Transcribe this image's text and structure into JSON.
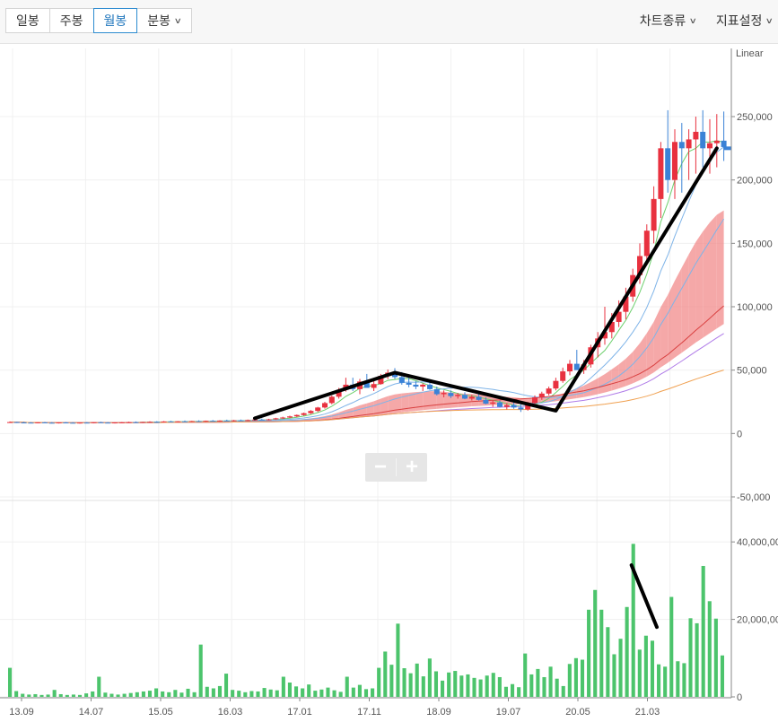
{
  "tabs": [
    {
      "label": "일봉",
      "active": false
    },
    {
      "label": "주봉",
      "active": false
    },
    {
      "label": "월봉",
      "active": true
    },
    {
      "label": "분봉",
      "active": false,
      "dropdown": true
    }
  ],
  "menu": {
    "chart_type": "차트종류",
    "indicator_settings": "지표설정"
  },
  "zoom": {
    "minus": "−",
    "plus": "+"
  },
  "colors": {
    "up": "#e8313f",
    "down": "#3b82d6",
    "volume": "#4cc46c",
    "cloud_down": "#a9cdf3",
    "cloud_up": "#f28b8b",
    "trendline": "#000000"
  },
  "chart_data": [
    {
      "type": "candlestick",
      "scale_label": "Linear",
      "ylim": [
        -50000,
        250000
      ],
      "y_ticks": [
        {
          "value": 250000,
          "label": "250,000"
        },
        {
          "value": 200000,
          "label": "200,000"
        },
        {
          "value": 150000,
          "label": "150,000"
        },
        {
          "value": 100000,
          "label": "100,000"
        },
        {
          "value": 50000,
          "label": "50,000"
        },
        {
          "value": 0,
          "label": "0"
        },
        {
          "value": -50000,
          "label": "-50,000"
        }
      ],
      "x_ticks": [
        "13.09",
        "14.07",
        "15.05",
        "16.03",
        "17.01",
        "17.11",
        "18.09",
        "19.07",
        "20.05",
        "21.03"
      ],
      "period_count": 103,
      "ohlc": [
        [
          9000,
          9500,
          8500,
          9000
        ],
        [
          9000,
          9200,
          8300,
          8700
        ],
        [
          8700,
          9100,
          8200,
          8600
        ],
        [
          8600,
          9000,
          8100,
          8400
        ],
        [
          8400,
          8900,
          8000,
          8800
        ],
        [
          8800,
          9200,
          8300,
          8500
        ],
        [
          8500,
          9000,
          8000,
          8300
        ],
        [
          8300,
          8800,
          7900,
          8700
        ],
        [
          8700,
          9100,
          8200,
          8500
        ],
        [
          8500,
          8900,
          8000,
          8200
        ],
        [
          8200,
          8700,
          7800,
          8600
        ],
        [
          8600,
          9000,
          8100,
          8400
        ],
        [
          8400,
          8800,
          8000,
          8900
        ],
        [
          8900,
          9300,
          8400,
          8600
        ],
        [
          8600,
          9000,
          8100,
          8300
        ],
        [
          8300,
          8800,
          7900,
          8700
        ],
        [
          8700,
          9100,
          8200,
          8800
        ],
        [
          8800,
          9300,
          8300,
          9000
        ],
        [
          9000,
          9500,
          8500,
          8700
        ],
        [
          8700,
          9200,
          8200,
          9100
        ],
        [
          9100,
          9600,
          8600,
          9200
        ],
        [
          9200,
          9700,
          8700,
          9000
        ],
        [
          9000,
          9800,
          8600,
          9500
        ],
        [
          9500,
          10000,
          9000,
          9200
        ],
        [
          9200,
          9800,
          8800,
          9600
        ],
        [
          9600,
          10200,
          9100,
          9400
        ],
        [
          9400,
          10000,
          9000,
          9800
        ],
        [
          9800,
          10400,
          9300,
          9600
        ],
        [
          9600,
          10200,
          9100,
          10000
        ],
        [
          10000,
          10600,
          9500,
          9800
        ],
        [
          9800,
          10400,
          9300,
          10200
        ],
        [
          10200,
          10900,
          9700,
          10000
        ],
        [
          10000,
          10700,
          9500,
          10400
        ],
        [
          10400,
          11000,
          9900,
          10200
        ],
        [
          10200,
          11000,
          9800,
          10600
        ],
        [
          10600,
          11400,
          10100,
          11000
        ],
        [
          11000,
          11800,
          10500,
          10800
        ],
        [
          10800,
          11600,
          10300,
          11200
        ],
        [
          11200,
          12400,
          10700,
          12000
        ],
        [
          12000,
          13200,
          11500,
          12600
        ],
        [
          12600,
          14000,
          12100,
          13500
        ],
        [
          13500,
          15000,
          12900,
          14600
        ],
        [
          14600,
          16500,
          14000,
          16000
        ],
        [
          16000,
          18500,
          15300,
          17800
        ],
        [
          17800,
          21000,
          17000,
          20500
        ],
        [
          20500,
          25000,
          19600,
          24000
        ],
        [
          24000,
          30000,
          23000,
          29000
        ],
        [
          29000,
          36000,
          27500,
          34500
        ],
        [
          34500,
          44000,
          33000,
          38500
        ],
        [
          38500,
          44000,
          33500,
          35000
        ],
        [
          35000,
          43000,
          31000,
          41000
        ],
        [
          41000,
          47000,
          36500,
          36000
        ],
        [
          36000,
          43000,
          33500,
          39000
        ],
        [
          39000,
          47000,
          38500,
          45500
        ],
        [
          45500,
          50500,
          43000,
          48000
        ],
        [
          48000,
          51500,
          43000,
          44500
        ],
        [
          44500,
          48500,
          38500,
          40000
        ],
        [
          40000,
          44000,
          36500,
          38500
        ],
        [
          38500,
          41500,
          35000,
          37000
        ],
        [
          37000,
          39500,
          33500,
          38500
        ],
        [
          38500,
          41000,
          34500,
          35000
        ],
        [
          35000,
          37000,
          30000,
          31000
        ],
        [
          31000,
          34000,
          28500,
          32000
        ],
        [
          32000,
          34000,
          28000,
          29500
        ],
        [
          29500,
          32000,
          27500,
          30500
        ],
        [
          30500,
          32500,
          27000,
          27500
        ],
        [
          27500,
          30500,
          26000,
          29000
        ],
        [
          29000,
          31000,
          26000,
          26500
        ],
        [
          26500,
          28500,
          23000,
          23500
        ],
        [
          23500,
          26000,
          21000,
          24500
        ],
        [
          24500,
          26000,
          20500,
          21000
        ],
        [
          21000,
          24000,
          19000,
          22500
        ],
        [
          22500,
          25000,
          19500,
          20500
        ],
        [
          20500,
          23000,
          17000,
          19000
        ],
        [
          19000,
          25000,
          18000,
          24000
        ],
        [
          24000,
          30000,
          23000,
          28500
        ],
        [
          28500,
          33000,
          26500,
          31500
        ],
        [
          31500,
          37000,
          30000,
          35500
        ],
        [
          35500,
          44000,
          34000,
          41500
        ],
        [
          41500,
          52000,
          40000,
          49000
        ],
        [
          49000,
          58000,
          46000,
          55000
        ],
        [
          55000,
          66000,
          52000,
          50000
        ],
        [
          50000,
          58000,
          47000,
          54500
        ],
        [
          54500,
          70000,
          52000,
          68000
        ],
        [
          68000,
          80000,
          60000,
          75000
        ],
        [
          75000,
          100000,
          70000,
          80000
        ],
        [
          80000,
          95000,
          75000,
          88000
        ],
        [
          88000,
          105000,
          84000,
          96000
        ],
        [
          96000,
          115000,
          90000,
          108000
        ],
        [
          108000,
          130000,
          104000,
          125000
        ],
        [
          125000,
          150000,
          118000,
          140000
        ],
        [
          140000,
          165000,
          135000,
          160000
        ],
        [
          160000,
          195000,
          150000,
          185000
        ],
        [
          185000,
          230000,
          170000,
          225000
        ],
        [
          225000,
          255000,
          190000,
          200000
        ],
        [
          200000,
          240000,
          185000,
          230000
        ],
        [
          230000,
          245000,
          190000,
          225000
        ],
        [
          225000,
          240000,
          200000,
          232000
        ],
        [
          232000,
          250000,
          205000,
          238000
        ],
        [
          238000,
          255000,
          210000,
          225000
        ],
        [
          225000,
          248000,
          205000,
          229000
        ],
        [
          229000,
          252000,
          210000,
          231000
        ],
        [
          231000,
          254000,
          215000,
          226000
        ]
      ],
      "current_price": 225000,
      "trendline": [
        {
          "period": 35,
          "value": 12000
        },
        {
          "period": 55,
          "value": 48000
        },
        {
          "period": 78,
          "value": 18000
        },
        {
          "period": 101,
          "value": 225000
        }
      ]
    },
    {
      "type": "bar",
      "name": "volume",
      "ylim": [
        0,
        50000000
      ],
      "y_ticks": [
        {
          "value": 0,
          "label": "0"
        },
        {
          "value": 20000000,
          "label": "20,000,000"
        },
        {
          "value": 40000000,
          "label": "40,000,000"
        }
      ],
      "values": [
        7500000,
        1500000,
        800000,
        600000,
        700000,
        500000,
        600000,
        1800000,
        700000,
        500000,
        600000,
        500000,
        900000,
        1400000,
        5200000,
        1100000,
        800000,
        600000,
        800000,
        1000000,
        1200000,
        1400000,
        1600000,
        2200000,
        1400000,
        1200000,
        1800000,
        1100000,
        2100000,
        1200000,
        13500000,
        2600000,
        2200000,
        2800000,
        6000000,
        1800000,
        1600000,
        1200000,
        1500000,
        1400000,
        2300000,
        1900000,
        1700000,
        5200000,
        3700000,
        2700000,
        2200000,
        3200000,
        1600000,
        1900000,
        2400000,
        1700000,
        1300000,
        5200000,
        2400000,
        3100000,
        2000000,
        2200000,
        7500000,
        11700000,
        8300000,
        18900000,
        7400000,
        6100000,
        8600000,
        5300000,
        9900000,
        6600000,
        4200000,
        6300000,
        6700000,
        5500000,
        5800000,
        4900000,
        4500000,
        5500000,
        6200000,
        5100000,
        2600000,
        3300000,
        2500000,
        11200000,
        5800000,
        7200000,
        5100000,
        7800000,
        4700000,
        2800000,
        8500000,
        10000000,
        9600000,
        22500000,
        27600000,
        22500000,
        18000000,
        11000000,
        15000000,
        23200000,
        39500000,
        12200000,
        15800000,
        14500000,
        8400000,
        7800000,
        25800000,
        9200000,
        8700000,
        20300000,
        19000000,
        33800000,
        24700000,
        20200000,
        10700000
      ],
      "trendline": [
        {
          "period": 98,
          "value": 34000000
        },
        {
          "period": 102,
          "value": 18000000
        }
      ]
    }
  ]
}
